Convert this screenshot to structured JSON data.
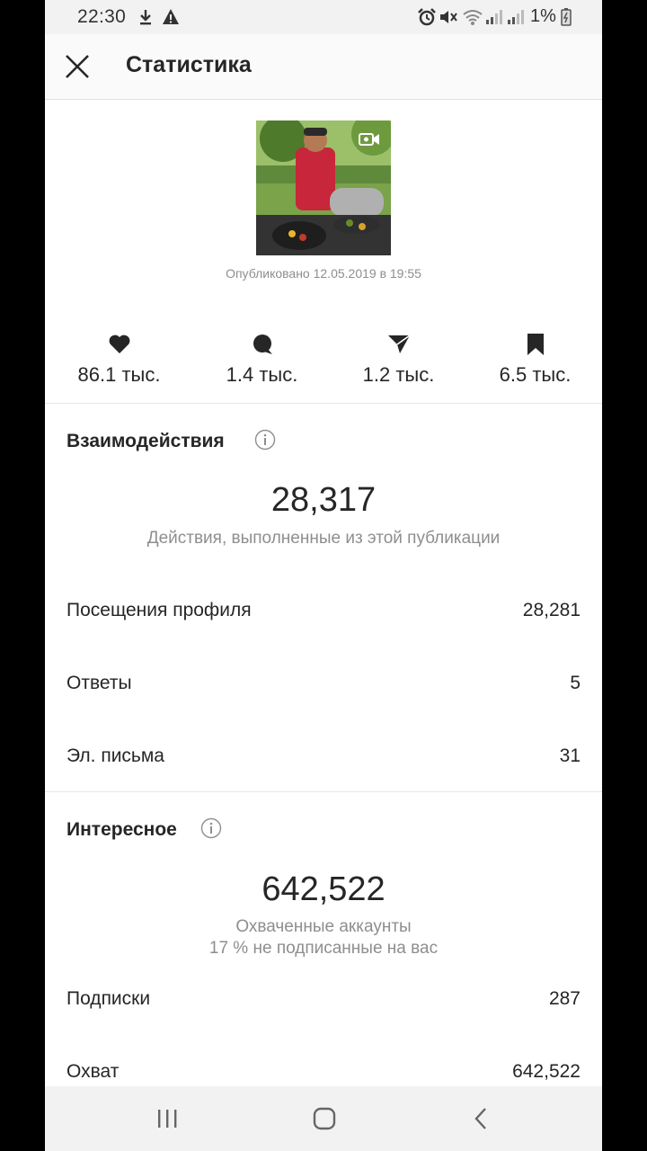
{
  "status_bar": {
    "time": "22:30",
    "battery": "1%",
    "icons": [
      "download-icon",
      "warning-icon",
      "alarm-icon",
      "mute-icon",
      "wifi-icon",
      "signal-icon",
      "signal-icon",
      "battery-icon"
    ]
  },
  "header": {
    "title": "Статистика",
    "close_icon": "close-icon"
  },
  "post": {
    "published": "Опубликовано 12.05.2019 в 19:55",
    "thumbnail_icon": "video-camera-icon"
  },
  "metrics": [
    {
      "icon": "heart-icon",
      "value": "86.1 тыс."
    },
    {
      "icon": "comment-icon",
      "value": "1.4 тыс."
    },
    {
      "icon": "send-icon",
      "value": "1.2 тыс."
    },
    {
      "icon": "bookmark-icon",
      "value": "6.5 тыс."
    }
  ],
  "interactions": {
    "title": "Взаимодействия",
    "total": "28,317",
    "description": "Действия, выполненные из этой публикации",
    "rows": [
      {
        "label": "Посещения профиля",
        "value": "28,281"
      },
      {
        "label": "Ответы",
        "value": "5"
      },
      {
        "label": "Эл. письма",
        "value": "31"
      }
    ]
  },
  "discovery": {
    "title": "Интересное",
    "total": "642,522",
    "description_line1": "Охваченные аккаунты",
    "description_line2": "17 % не подписанные на вас",
    "rows": [
      {
        "label": "Подписки",
        "value": "287"
      },
      {
        "label": "Охват",
        "value": "642,522"
      }
    ]
  },
  "colors": {
    "text_primary": "#262626",
    "text_secondary": "#8e8e8e",
    "background": "#ffffff",
    "system_bar": "#f2f2f2"
  }
}
